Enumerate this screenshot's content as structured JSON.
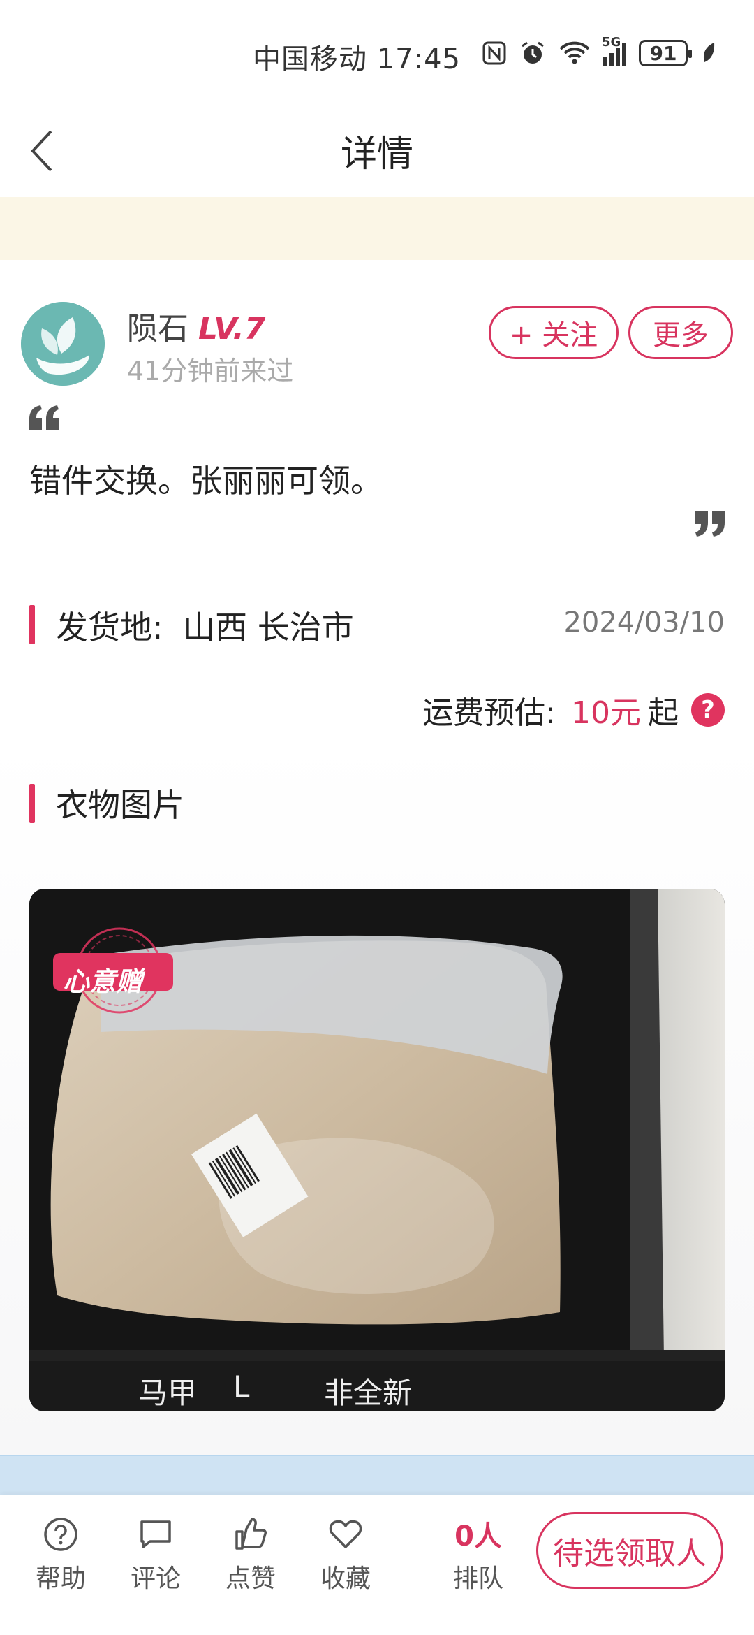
{
  "status_bar": {
    "carrier": "中国移动",
    "time": "17:45",
    "signal_label": "5G",
    "battery": "91"
  },
  "nav": {
    "title": "详情"
  },
  "user": {
    "name": "陨石",
    "level": "LV.7",
    "last_seen": "41分钟前来过",
    "follow_label": "+ 关注",
    "more_label": "更多"
  },
  "post": {
    "message": "错件交换。张丽丽可领。",
    "origin_label": "发货地:",
    "origin_value": "山西 长治市",
    "date": "2024/03/10",
    "shipping_label": "运费预估:",
    "shipping_price": "10元",
    "shipping_suffix": "起",
    "help_mark": "?"
  },
  "photos": {
    "section_title": "衣物图片",
    "badge_text": "心意赠",
    "item_type": "马甲",
    "item_size": "L",
    "item_condition": "非全新"
  },
  "bottom_bar": {
    "help_label": "帮助",
    "comment_label": "评论",
    "like_label": "点赞",
    "favorite_label": "收藏",
    "queue_count": "0人",
    "queue_label": "排队",
    "claim_label": "待选领取人"
  },
  "colors": {
    "accent": "#d8345f",
    "notice_bg": "#fbf6e6",
    "avatar_bg": "#6bb8b2"
  }
}
